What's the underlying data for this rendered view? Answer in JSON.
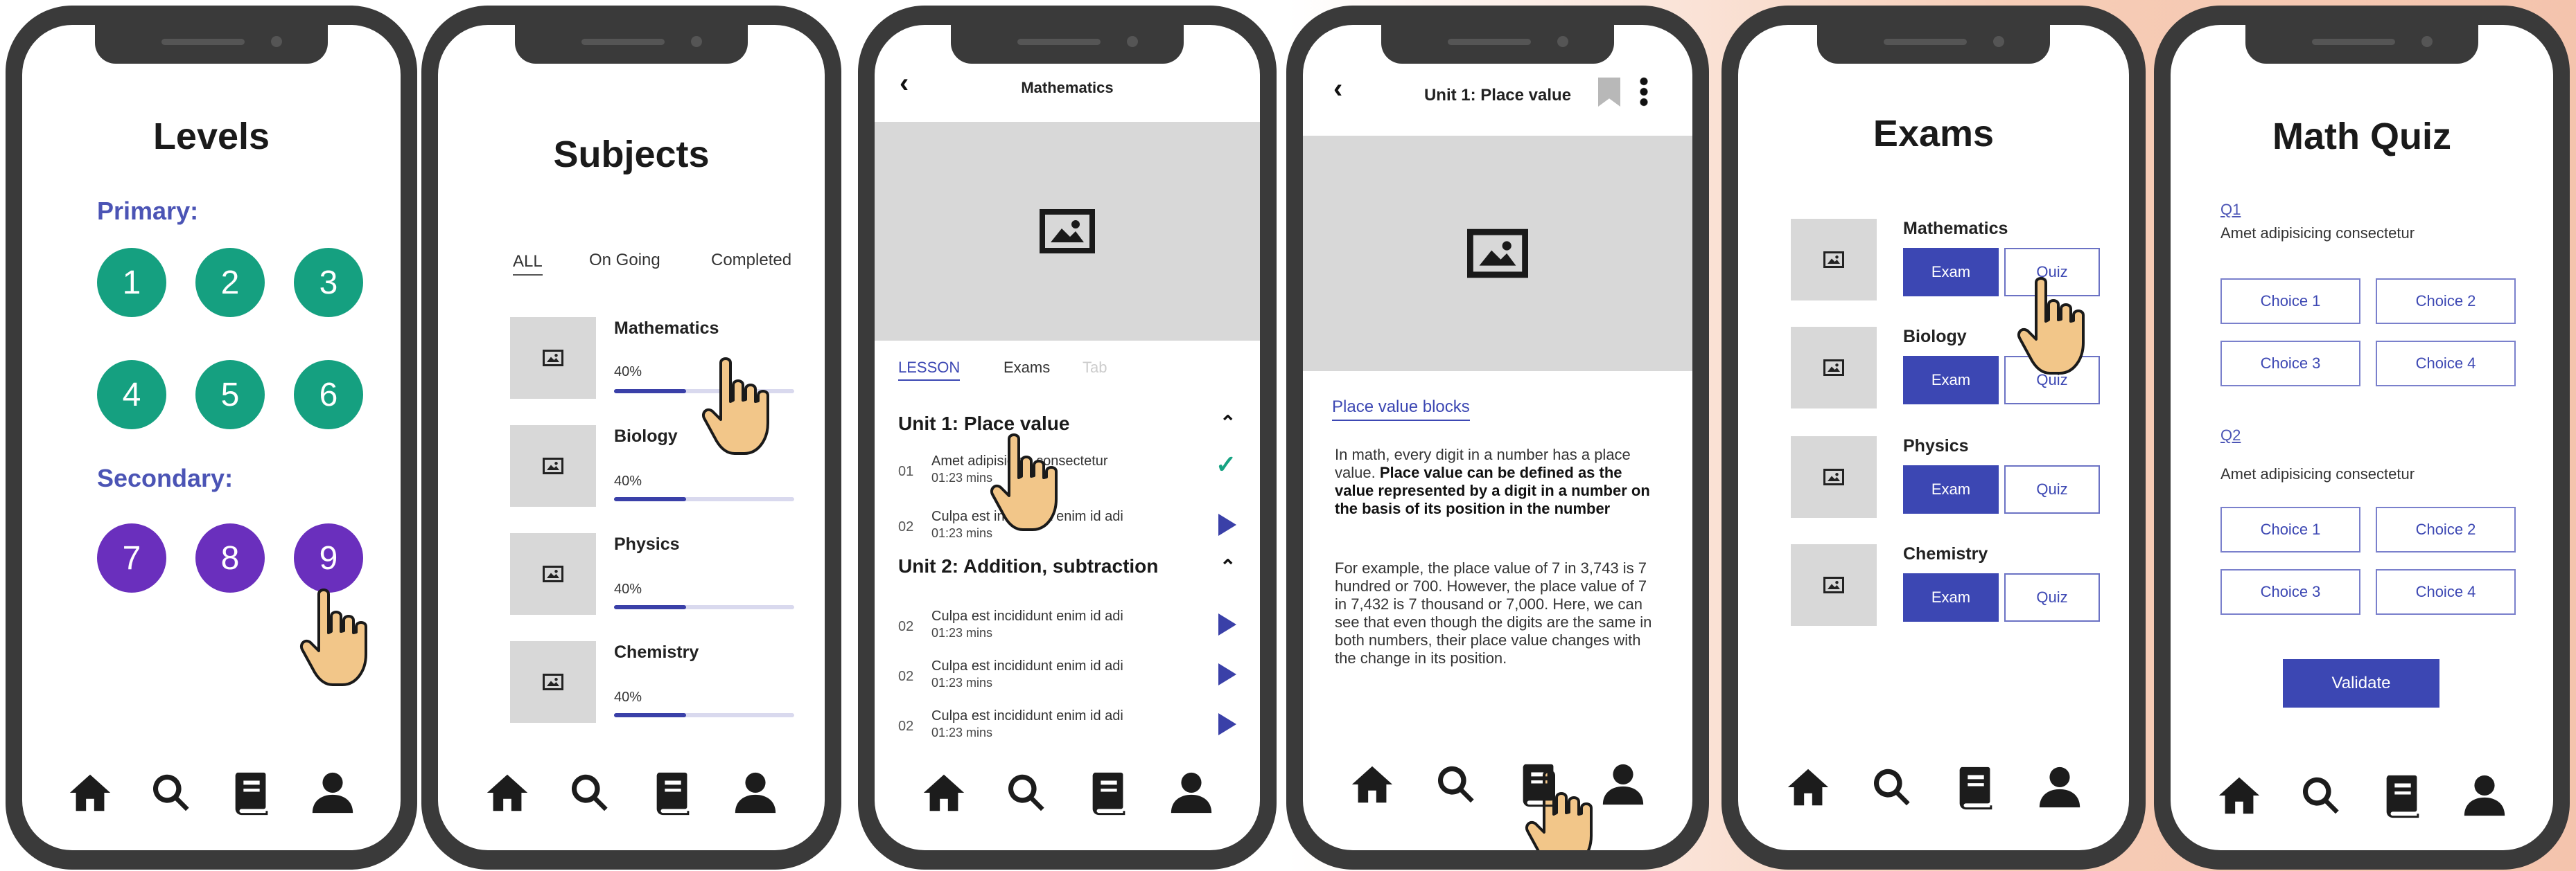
{
  "levels": {
    "title": "Levels",
    "primary_label": "Primary:",
    "secondary_label": "Secondary:",
    "primary": [
      "1",
      "2",
      "3",
      "4",
      "5",
      "6"
    ],
    "secondary": [
      "7",
      "8",
      "9"
    ]
  },
  "subjects": {
    "title": "Subjects",
    "tabs": [
      "ALL",
      "On Going",
      "Completed"
    ],
    "items": [
      {
        "name": "Mathematics",
        "progress": "40%",
        "value": 0.4
      },
      {
        "name": "Biology",
        "progress": "40%",
        "value": 0.4
      },
      {
        "name": "Physics",
        "progress": "40%",
        "value": 0.4
      },
      {
        "name": "Chemistry",
        "progress": "40%",
        "value": 0.4
      }
    ]
  },
  "lesson": {
    "header": "Mathematics",
    "tabs": [
      "LESSON",
      "Exams",
      "Tab"
    ],
    "unit1": {
      "title": "Unit 1: Place value",
      "rows": [
        {
          "num": "01",
          "text": "Amet adipisicing consectetur",
          "time": "01:23 mins"
        },
        {
          "num": "02",
          "text": "Culpa est incididunt enim id adi",
          "time": "01:23 mins"
        }
      ]
    },
    "unit2": {
      "title": "Unit 2: Addition, subtraction",
      "rows": [
        {
          "num": "02",
          "text": "Culpa est incididunt enim id adi",
          "time": "01:23 mins"
        },
        {
          "num": "02",
          "text": "Culpa est incididunt enim id adi",
          "time": "01:23 mins"
        },
        {
          "num": "02",
          "text": "Culpa est incididunt enim id adi",
          "time": "01:23 mins"
        }
      ]
    }
  },
  "article": {
    "header": "Unit 1: Place value",
    "link": "Place value blocks",
    "p1_a": "In math, every digit in a number has a place value. ",
    "p1_b": "Place value can be defined as the value represented by a digit in a number on the basis of its position in the number",
    "p2": "For example, the place value of 7 in 3,743 is 7 hundred or 700. However, the place value of 7 in 7,432 is 7 thousand or 7,000. Here, we can see that even though the digits are the same in both numbers, their place value changes with the change in its position."
  },
  "exams": {
    "title": "Exams",
    "items": [
      {
        "name": "Mathematics",
        "exam": "Exam",
        "quiz": "Quiz"
      },
      {
        "name": "Biology",
        "exam": "Exam",
        "quiz": "Quiz"
      },
      {
        "name": "Physics",
        "exam": "Exam",
        "quiz": "Quiz"
      },
      {
        "name": "Chemistry",
        "exam": "Exam",
        "quiz": "Quiz"
      }
    ]
  },
  "quiz": {
    "title": "Math Quiz",
    "questions": [
      {
        "label": "Q1",
        "text": "Amet adipisicing consectetur",
        "choices": [
          "Choice 1",
          "Choice 2",
          "Choice 3",
          "Choice 4"
        ]
      },
      {
        "label": "Q2",
        "text": "Amet adipisicing consectetur",
        "choices": [
          "Choice 1",
          "Choice 2",
          "Choice 3",
          "Choice 4"
        ]
      }
    ],
    "validate": "Validate"
  },
  "nav_icons": [
    "home-icon",
    "search-icon",
    "book-icon",
    "user-icon"
  ],
  "colors": {
    "accent": "#3c47b3",
    "primary_circle": "#15a080",
    "secondary_circle": "#6a2fbd",
    "check": "#17a383"
  }
}
